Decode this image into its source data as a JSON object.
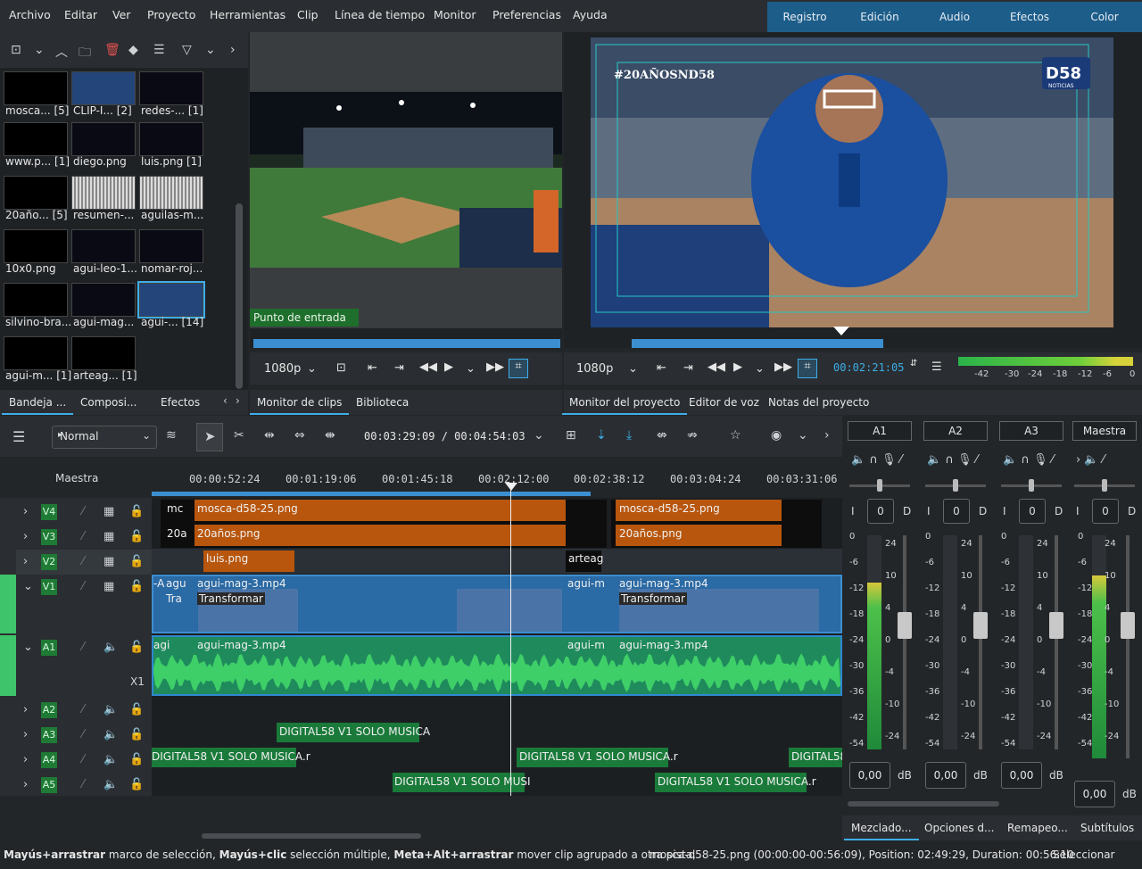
{
  "menu": [
    "Archivo",
    "Editar",
    "Ver",
    "Proyecto",
    "Herramientas",
    "Clip",
    "Línea de tiempo",
    "Monitor",
    "Preferencias",
    "Ayuda"
  ],
  "workspaces": [
    "Registro",
    "Edición",
    "Audio",
    "Efectos",
    "Color"
  ],
  "bin": {
    "items": [
      {
        "label": "mosca... [5]"
      },
      {
        "label": "CLIP-I... [2]"
      },
      {
        "label": "redes-... [1]"
      },
      {
        "label": "www.p... [1]"
      },
      {
        "label": "diego.png"
      },
      {
        "label": "luis.png [1]"
      },
      {
        "label": "20año... [5]"
      },
      {
        "label": "resumen-..."
      },
      {
        "label": "aguilas-m..."
      },
      {
        "label": "10x0.png"
      },
      {
        "label": "agui-leo-1..."
      },
      {
        "label": "nomar-roj..."
      },
      {
        "label": "silvino-bra..."
      },
      {
        "label": "agui-mag..."
      },
      {
        "label": "agui-... [14]"
      },
      {
        "label": "agui-m... [1]"
      },
      {
        "label": "arteag... [1]"
      }
    ],
    "tabs": [
      "Bandeja ...",
      "Composi...",
      "Efectos"
    ]
  },
  "clip_monitor": {
    "in_point_label": "Punto de entrada",
    "resolution": "1080p",
    "tabs": [
      "Monitor de clips",
      "Biblioteca"
    ]
  },
  "project_monitor": {
    "resolution": "1080p",
    "timecode": "00:02:21:05",
    "overlay_hashtag": "#20AÑOSND58",
    "overlay_logo": "D58",
    "overlay_logo_sub": "NOTICIAS",
    "tabs": [
      "Monitor del proyecto",
      "Editor de voz",
      "Notas del proyecto"
    ],
    "meter_scale": [
      "-42",
      "-30",
      "-24",
      "-18",
      "-12",
      "-6",
      "0"
    ]
  },
  "timeline_toolbar": {
    "mode": "Normal",
    "position": "00:03:29:09 / 00:04:54:03"
  },
  "timeline": {
    "master_label": "Maestra",
    "ruler_ticks": [
      "00:00:52:24",
      "00:01:19:06",
      "00:01:45:18",
      "00:02:12:00",
      "00:02:38:12",
      "00:03:04:24",
      "00:03:31:06"
    ],
    "tracks": [
      {
        "name": "V4"
      },
      {
        "name": "V3"
      },
      {
        "name": "V2"
      },
      {
        "name": "V1"
      },
      {
        "name": "A1"
      },
      {
        "name": "A2"
      },
      {
        "name": "A3"
      },
      {
        "name": "A4"
      },
      {
        "name": "A5"
      }
    ],
    "a1_extra": "X1",
    "clips": {
      "v4_short": "mc",
      "v4_a": "mosca-d58-25.png",
      "v4_b": "mosca-d58-25.png",
      "v3_short": "20a",
      "v3_a": "20años.png",
      "v3_b": "20años.png",
      "v2_a": "luis.png",
      "v2_b": "arteag",
      "v1_a": "agui-mag-3.mp4",
      "v1_a_effect": "Transformar",
      "v1_b": "agui-mag-3.mp4",
      "v1_b_effect": "Transformar",
      "v1_c": "agui-m",
      "v1_small_a": "-A",
      "v1_small_b": "agu",
      "v1_small_c": "Tra",
      "a1_a": "agui-mag-3.mp4",
      "a1_b": "agui-m",
      "a1_c": "agui-mag-3.mp4",
      "a1_small": "agi",
      "music_1": "DIGITAL58 V1 SOLO MUSICA",
      "music_2": "DIGITAL58 V1 SOLO MUSICA.r",
      "music_3": "DIGITAL58 V1 SOLO MUSICA.r",
      "music_4": "DIGITAL58",
      "music_5": "DIGITAL58 V1 SOLO MUSI",
      "music_6": "DIGITAL58 V1 SOLO MUSICA.r"
    }
  },
  "mixer": {
    "channels": [
      {
        "name": "A1",
        "value": "0",
        "db": "0,00",
        "level": 0.78
      },
      {
        "name": "A2",
        "value": "0",
        "db": "0,00",
        "level": 0.0
      },
      {
        "name": "A3",
        "value": "0",
        "db": "0,00",
        "level": 0.0
      },
      {
        "name": "Maestra",
        "value": "0",
        "db": "0,00",
        "level": 0.82
      }
    ],
    "left_label": "I",
    "right_label": "D",
    "db_unit": "dB",
    "scale_left": [
      "0",
      "-6",
      "-12",
      "-18",
      "-24",
      "-30",
      "-36",
      "-42",
      "-54"
    ],
    "scale_right": [
      "24",
      "10",
      "4",
      "0",
      "-4",
      "-10",
      "-24"
    ],
    "tabs": [
      "Mezclado...",
      "Opciones d...",
      "Remapeo...",
      "Subtítulos"
    ]
  },
  "statusbar": {
    "hint_1_bold": "Mayús+arrastrar",
    "hint_1": " marco de selección, ",
    "hint_2_bold": "Mayús+clic",
    "hint_2": " selección múltiple, ",
    "hint_3_bold": "Meta+Alt+arrastrar",
    "hint_3": " mover clip agrupado a otra pista,",
    "clip_info": "mosca-d58-25.png (00:00:00-00:56:09), Position: 02:49:29, Duration: 00:56:10",
    "tool": "Seleccionar"
  },
  "colors": {
    "accent": "#3daee9",
    "clip_orange": "#b8560d",
    "video_blue": "#2b6aa3",
    "audio_green": "#1f8a5c",
    "track_green": "#1e7a34"
  }
}
